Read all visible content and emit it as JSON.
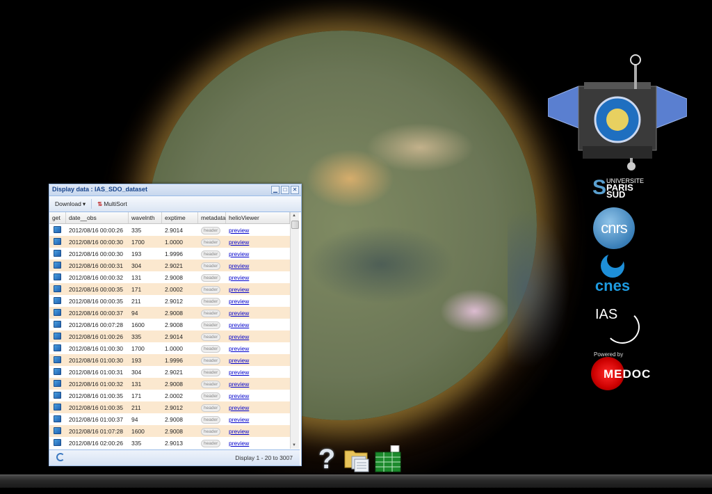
{
  "window": {
    "title": "Display data : IAS_SDO_dataset",
    "toolbar": {
      "download_label": "Download",
      "multisort_label": "MultiSort"
    },
    "columns": [
      "get",
      "date__obs",
      "wavelnth",
      "exptime",
      "metadata",
      "helioViewer"
    ],
    "rows": [
      {
        "date": "2012/08/16 00:00:26",
        "wave": "335",
        "exp": "2.9014",
        "meta": "header",
        "link": "preview"
      },
      {
        "date": "2012/08/16 00:00:30",
        "wave": "1700",
        "exp": "1.0000",
        "meta": "header",
        "link": "preview"
      },
      {
        "date": "2012/08/16 00:00:30",
        "wave": "193",
        "exp": "1.9996",
        "meta": "header",
        "link": "preview"
      },
      {
        "date": "2012/08/16 00:00:31",
        "wave": "304",
        "exp": "2.9021",
        "meta": "header",
        "link": "preview"
      },
      {
        "date": "2012/08/16 00:00:32",
        "wave": "131",
        "exp": "2.9008",
        "meta": "header",
        "link": "preview"
      },
      {
        "date": "2012/08/16 00:00:35",
        "wave": "171",
        "exp": "2.0002",
        "meta": "header",
        "link": "preview"
      },
      {
        "date": "2012/08/16 00:00:35",
        "wave": "211",
        "exp": "2.9012",
        "meta": "header",
        "link": "preview"
      },
      {
        "date": "2012/08/16 00:00:37",
        "wave": "94",
        "exp": "2.9008",
        "meta": "header",
        "link": "preview"
      },
      {
        "date": "2012/08/16 00:07:28",
        "wave": "1600",
        "exp": "2.9008",
        "meta": "header",
        "link": "preview"
      },
      {
        "date": "2012/08/16 01:00:26",
        "wave": "335",
        "exp": "2.9014",
        "meta": "header",
        "link": "preview"
      },
      {
        "date": "2012/08/16 01:00:30",
        "wave": "1700",
        "exp": "1.0000",
        "meta": "header",
        "link": "preview"
      },
      {
        "date": "2012/08/16 01:00:30",
        "wave": "193",
        "exp": "1.9996",
        "meta": "header",
        "link": "preview"
      },
      {
        "date": "2012/08/16 01:00:31",
        "wave": "304",
        "exp": "2.9021",
        "meta": "header",
        "link": "preview"
      },
      {
        "date": "2012/08/16 01:00:32",
        "wave": "131",
        "exp": "2.9008",
        "meta": "header",
        "link": "preview"
      },
      {
        "date": "2012/08/16 01:00:35",
        "wave": "171",
        "exp": "2.0002",
        "meta": "header",
        "link": "preview"
      },
      {
        "date": "2012/08/16 01:00:35",
        "wave": "211",
        "exp": "2.9012",
        "meta": "header",
        "link": "preview"
      },
      {
        "date": "2012/08/16 01:00:37",
        "wave": "94",
        "exp": "2.9008",
        "meta": "header",
        "link": "preview"
      },
      {
        "date": "2012/08/16 01:07:28",
        "wave": "1600",
        "exp": "2.9008",
        "meta": "header",
        "link": "preview"
      },
      {
        "date": "2012/08/16 02:00:26",
        "wave": "335",
        "exp": "2.9013",
        "meta": "header",
        "link": "preview"
      }
    ],
    "paging_text": "Display 1 - 20 to 3007"
  },
  "logos": {
    "paris_univ": "UNIVERSITE",
    "paris_name": "PARIS",
    "paris_sud": "SUD",
    "cnrs": "cnrs",
    "cnes": "cnes",
    "ias": "IAS",
    "medoc_powered": "Powered by",
    "medoc": "MEDOC"
  },
  "dock": {
    "help_glyph": "?"
  },
  "colors": {
    "window_border": "#99bbe8",
    "title_text": "#15428b",
    "row_alt": "#fbe8cf",
    "link": "#0000cc"
  },
  "icons": [
    "sun-image",
    "satellite-icon",
    "get-file-icon",
    "refresh-icon",
    "help-icon",
    "folder-files-icon",
    "grid-icon"
  ]
}
